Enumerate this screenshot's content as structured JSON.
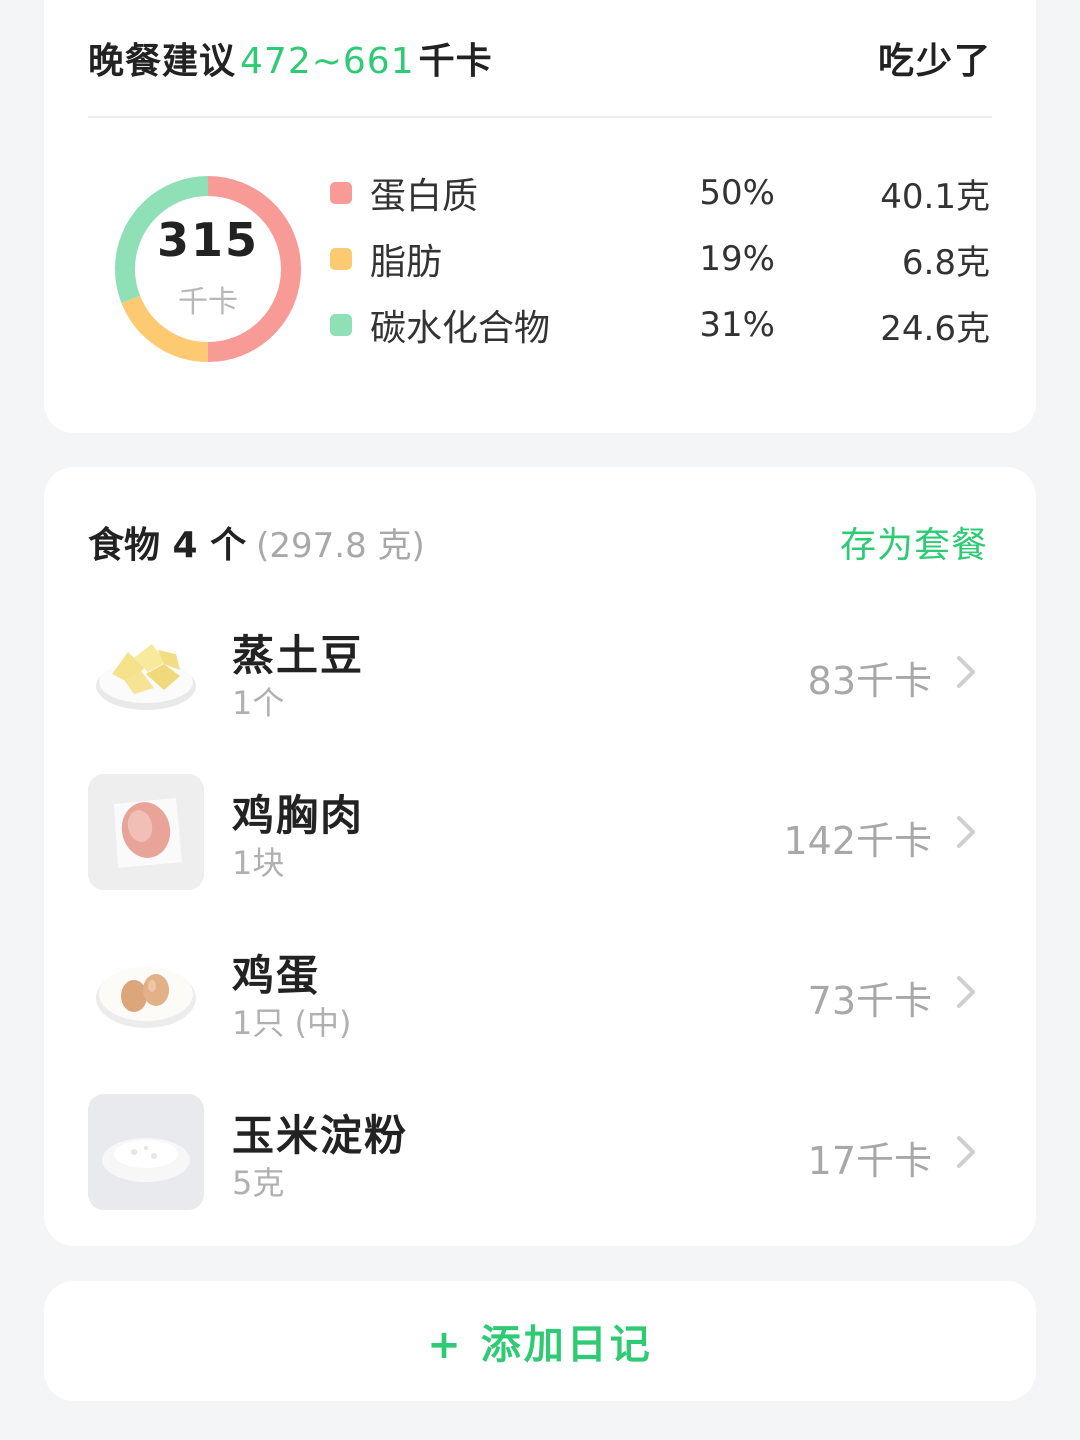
{
  "summary": {
    "meal_label": "晚餐建议",
    "kcal_range": "472~661",
    "kcal_unit": "千卡",
    "ate_less_label": "吃少了",
    "total_value": "315",
    "total_unit": "千卡",
    "macros": [
      {
        "name": "蛋白质",
        "percent": "50%",
        "amount": "40.1克",
        "color": "#f89a96",
        "share": 0.5
      },
      {
        "name": "脂肪",
        "percent": "19%",
        "amount": "6.8克",
        "color": "#fdca72",
        "share": 0.19
      },
      {
        "name": "碳水化合物",
        "percent": "31%",
        "amount": "24.6克",
        "color": "#8fdfb7",
        "share": 0.31
      }
    ]
  },
  "foods": {
    "title": "食物 4 个",
    "total_weight": "(297.8 克)",
    "save_label": "存为套餐",
    "items": [
      {
        "name": "蒸土豆",
        "qty": "1个",
        "kcal": "83千卡",
        "icon": "steamed-potato-photo"
      },
      {
        "name": "鸡胸肉",
        "qty": "1块",
        "kcal": "142千卡",
        "icon": "chicken-breast-photo"
      },
      {
        "name": "鸡蛋",
        "qty": "1只 (中)",
        "kcal": "73千卡",
        "icon": "eggs-photo"
      },
      {
        "name": "玉米淀粉",
        "qty": "5克",
        "kcal": "17千卡",
        "icon": "cornstarch-photo"
      }
    ]
  },
  "add_diary_label": "+ 添加日记",
  "colors": {
    "accent": "#2fcb74",
    "muted": "#a8a8a8"
  }
}
